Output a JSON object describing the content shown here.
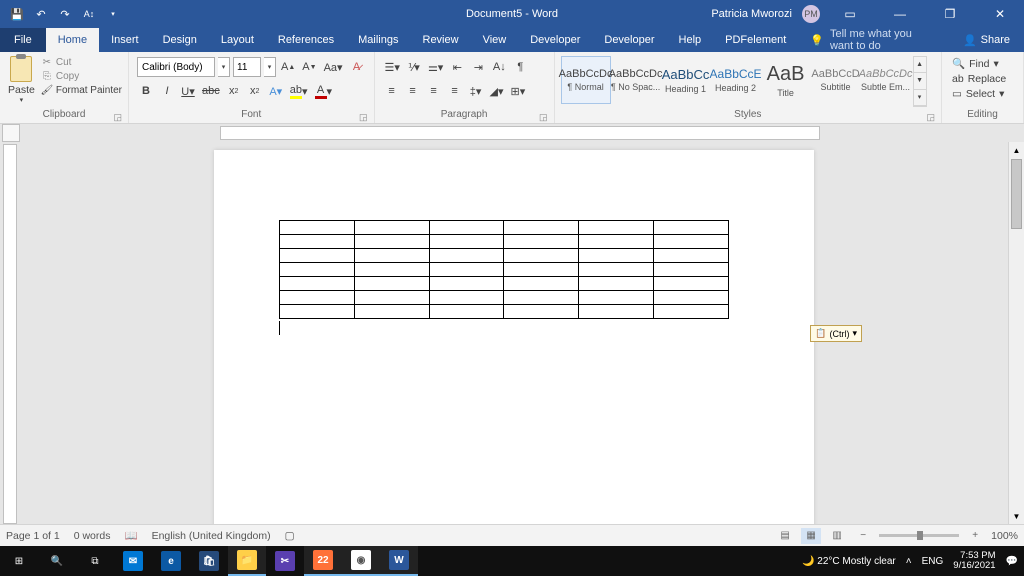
{
  "titlebar": {
    "doc_title": "Document5 - Word",
    "user_name": "Patricia Mworozi",
    "user_initials": "PM"
  },
  "menu": {
    "file": "File",
    "tabs": [
      "Home",
      "Insert",
      "Design",
      "Layout",
      "References",
      "Mailings",
      "Review",
      "View",
      "Developer",
      "Developer",
      "Help",
      "PDFelement"
    ],
    "active": "Home",
    "tell_me": "Tell me what you want to do",
    "share": "Share"
  },
  "ribbon": {
    "clipboard": {
      "label": "Clipboard",
      "paste": "Paste",
      "cut": "Cut",
      "copy": "Copy",
      "fmt": "Format Painter"
    },
    "font": {
      "label": "Font",
      "name": "Calibri (Body)",
      "size": "11"
    },
    "paragraph": {
      "label": "Paragraph"
    },
    "styles": {
      "label": "Styles",
      "items": [
        {
          "preview": "AaBbCcDc",
          "name": "¶ Normal",
          "sel": true,
          "cls": ""
        },
        {
          "preview": "AaBbCcDc",
          "name": "¶ No Spac...",
          "sel": false,
          "cls": ""
        },
        {
          "preview": "AaBbCc",
          "name": "Heading 1",
          "sel": false,
          "cls": "color:#1f4e79;font-size:13px"
        },
        {
          "preview": "AaBbCcE",
          "name": "Heading 2",
          "sel": false,
          "cls": "color:#2e74b5;font-size:12px"
        },
        {
          "preview": "AaB",
          "name": "Title",
          "sel": false,
          "cls": "font-size:20px"
        },
        {
          "preview": "AaBbCcD",
          "name": "Subtitle",
          "sel": false,
          "cls": "color:#7a7a7a"
        },
        {
          "preview": "AaBbCcDc",
          "name": "Subtle Em...",
          "sel": false,
          "cls": "font-style:italic;color:#888"
        }
      ]
    },
    "editing": {
      "label": "Editing",
      "find": "Find",
      "replace": "Replace",
      "select": "Select"
    }
  },
  "paste_tag": "(Ctrl)",
  "status": {
    "page": "Page 1 of 1",
    "words": "0 words",
    "lang": "English (United Kingdom)",
    "zoom": "100%"
  },
  "taskbar": {
    "weather": "22°C  Mostly clear",
    "ime": "ENG",
    "time": "7:53 PM",
    "date": "9/16/2021",
    "cal_day": "22"
  }
}
